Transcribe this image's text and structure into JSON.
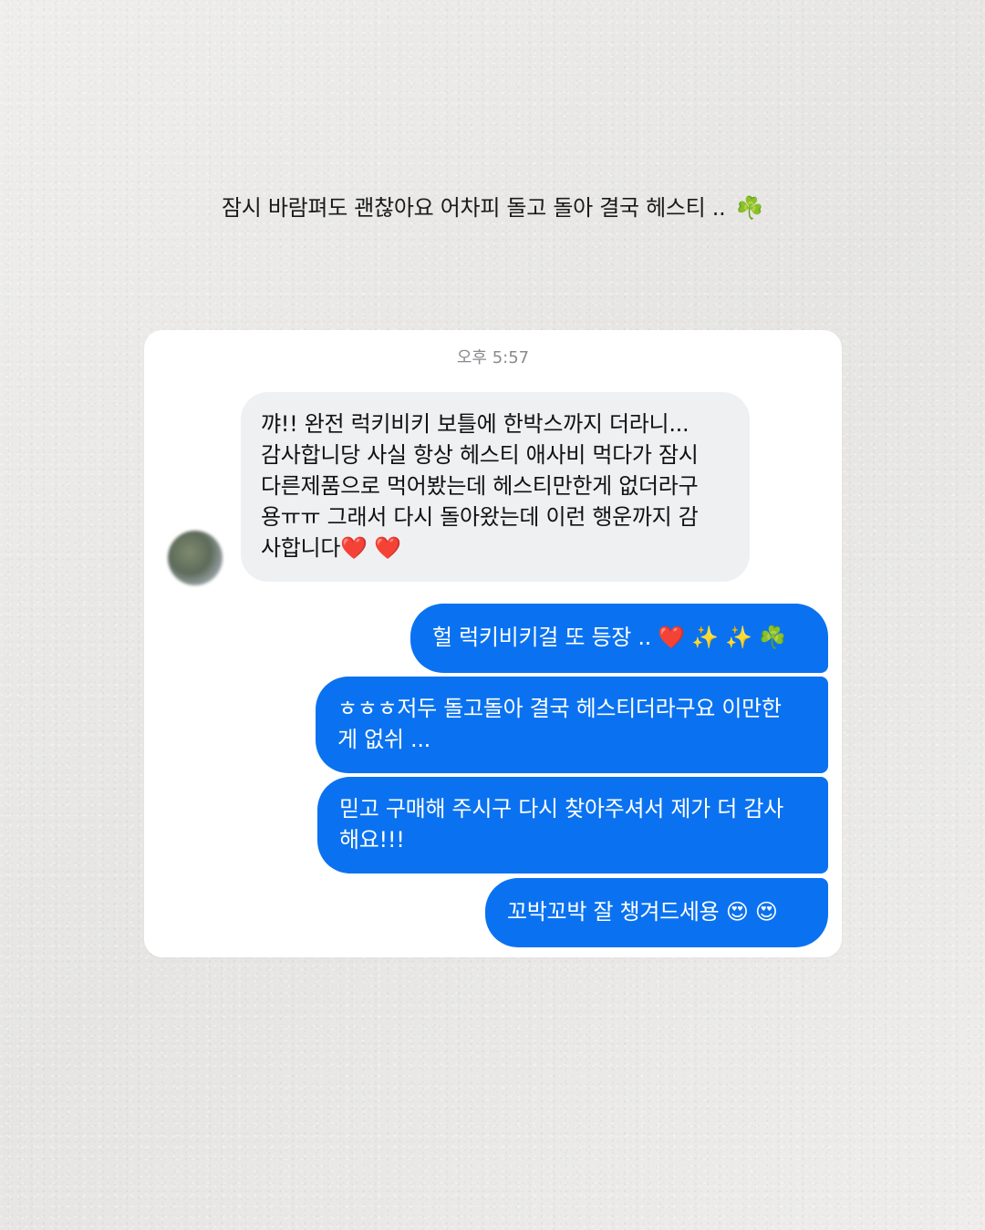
{
  "caption": {
    "text": "잠시 바람펴도 괜찮아요 어차피 돌고 돌아 결국 헤스티 ..",
    "emoji": "☘️"
  },
  "chat": {
    "timestamp": "오후 5:57",
    "incoming": [
      {
        "text": "꺄!! 완전 럭키비키 보틀에 한박스까지 더라니...\n감사합니당 사실 항상 헤스티 애사비 먹다가 잠시\n다른제품으로 먹어봤는데 헤스티만한게 없더라구\n용ㅠㅠ 그래서 다시 돌아왔는데 이런 행운까지 감\n사합니다",
        "emoji": "❤️ ❤️"
      }
    ],
    "outgoing": [
      {
        "text": "헐 럭키비키걸 또 등장 ..",
        "emoji": "❤️ ✨ ✨ ☘️"
      },
      {
        "text": "ㅎㅎㅎ저두 돌고돌아 결국 헤스티더라구요 이만한\n게 없쉬 ...",
        "emoji": ""
      },
      {
        "text": "믿고 구매해 주시구 다시 찾아주셔서 제가 더 감사\n해요!!!",
        "emoji": ""
      },
      {
        "text": "꼬박꼬박 잘 챙겨드세용",
        "emoji": "😍 😍"
      }
    ]
  },
  "colors": {
    "outgoing_bubble": "#0a72f0",
    "incoming_bubble": "#eff0f2",
    "card": "#ffffff",
    "background": "#ecebe9"
  },
  "icons": {
    "avatar": "blurred-profile-avatar"
  }
}
